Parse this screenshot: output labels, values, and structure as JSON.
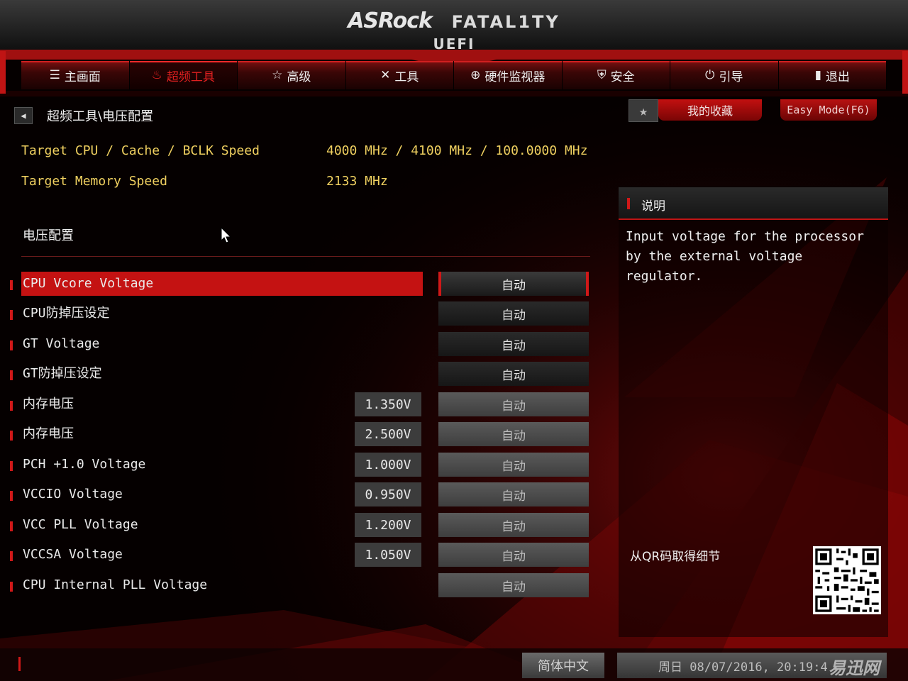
{
  "header": {
    "brand": "ASRock",
    "series": "FATAL1TY",
    "subtitle": "UEFI"
  },
  "tabs": [
    {
      "label": "主画面",
      "icon": "list-icon"
    },
    {
      "label": "超频工具",
      "icon": "flame-icon",
      "active": true
    },
    {
      "label": "高级",
      "icon": "star-arrow-icon"
    },
    {
      "label": "工具",
      "icon": "tools-icon"
    },
    {
      "label": "硬件监视器",
      "icon": "monitor-target-icon"
    },
    {
      "label": "安全",
      "icon": "shield-icon"
    },
    {
      "label": "引导",
      "icon": "power-icon"
    },
    {
      "label": "退出",
      "icon": "exit-door-icon"
    }
  ],
  "breadcrumb": "超频工具\\电压配置",
  "favorites_label": "我的收藏",
  "easy_mode_label": "Easy Mode(F6)",
  "info": [
    {
      "label": "Target CPU / Cache / BCLK Speed",
      "value": "4000 MHz / 4100 MHz / 100.0000 MHz"
    },
    {
      "label": "Target Memory Speed",
      "value": "2133 MHz"
    }
  ],
  "section_title": "电压配置",
  "rows": [
    {
      "label": "CPU Vcore Voltage",
      "value": "",
      "setting": "自动",
      "style": "sel",
      "selected": true
    },
    {
      "label": "CPU防掉压设定",
      "value": "",
      "setting": "自动",
      "style": "dark"
    },
    {
      "label": "GT Voltage",
      "value": "",
      "setting": "自动",
      "style": "dark"
    },
    {
      "label": "GT防掉压设定",
      "value": "",
      "setting": "自动",
      "style": "dark"
    },
    {
      "label": "内存电压",
      "value": "1.350V",
      "setting": "自动",
      "style": "light"
    },
    {
      "label": "内存电压",
      "value": "2.500V",
      "setting": "自动",
      "style": "light"
    },
    {
      "label": "PCH +1.0 Voltage",
      "value": "1.000V",
      "setting": "自动",
      "style": "light"
    },
    {
      "label": "VCCIO Voltage",
      "value": "0.950V",
      "setting": "自动",
      "style": "light"
    },
    {
      "label": "VCC PLL Voltage",
      "value": "1.200V",
      "setting": "自动",
      "style": "light"
    },
    {
      "label": "VCCSA Voltage",
      "value": "1.050V",
      "setting": "自动",
      "style": "light"
    },
    {
      "label": "CPU Internal PLL Voltage",
      "value": "",
      "setting": "自动",
      "style": "light"
    }
  ],
  "description": {
    "title": "说明",
    "text": "Input voltage for the processor by the external voltage regulator.",
    "qr_label": "从QR码取得细节"
  },
  "footer": {
    "language": "简体中文",
    "datetime": "周日 08/07/2016, 20:19:4",
    "watermark": "易迅网"
  },
  "colors": {
    "accent": "#d01818",
    "info_text": "#f0d060",
    "selected_row": "#c41212"
  }
}
